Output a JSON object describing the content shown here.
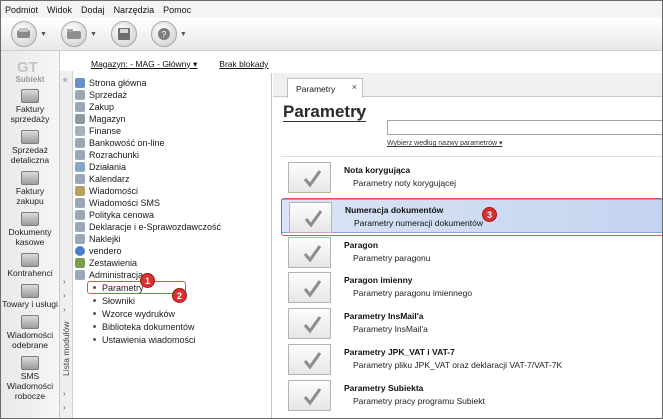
{
  "menu": [
    "Podmiot",
    "Widok",
    "Dodaj",
    "Narzędzia",
    "Pomoc"
  ],
  "logo": "Subiekt",
  "rail": [
    {
      "label": "Faktury sprzedaży"
    },
    {
      "label": "Sprzedaż detaliczna"
    },
    {
      "label": "Faktury zakupu"
    },
    {
      "label": "Dokumenty kasowe"
    },
    {
      "label": "Kontrahenci"
    },
    {
      "label": "Towary i usługi"
    },
    {
      "label": "Wiadomości odebrane"
    },
    {
      "label": "SMS Wiadomości robocze"
    }
  ],
  "side_strip": "Lista modułów",
  "storebar": {
    "warehouse": "Magazyn: - MAG - Główny ▾",
    "lock": "Brak blokady"
  },
  "nav": [
    {
      "label": "Strona główna",
      "color": "#6a8fc7"
    },
    {
      "label": "Sprzedaż",
      "color": "#9aa8b8"
    },
    {
      "label": "Zakup",
      "color": "#9aa8b8"
    },
    {
      "label": "Magazyn",
      "color": "#8c9aa8"
    },
    {
      "label": "Finanse",
      "color": "#a8b0ba"
    },
    {
      "label": "Bankowość on-line",
      "color": "#9aa8b8"
    },
    {
      "label": "Rozrachunki",
      "color": "#9aa8b8"
    },
    {
      "label": "Działania",
      "color": "#8aa6c7"
    },
    {
      "label": "Kalendarz",
      "color": "#9aa8b8"
    },
    {
      "label": "Wiadomości",
      "color": "#b8a060"
    },
    {
      "label": "Wiadomości SMS",
      "color": "#9aa8b8"
    },
    {
      "label": "Polityka cenowa",
      "color": "#9aa8b8"
    },
    {
      "label": "Deklaracje i e-Sprawozdawczość",
      "color": "#9aa8b8"
    },
    {
      "label": "Naklejki",
      "color": "#9aa8b8"
    },
    {
      "label": "vendero",
      "color": "#4a7fc7"
    },
    {
      "label": "Zestawienia",
      "color": "#78a050"
    },
    {
      "label": "Administracja",
      "color": "#9aa8b8"
    }
  ],
  "nav_sub": [
    "Parametry",
    "Słowniki",
    "Wzorce wydruków",
    "Biblioteka dokumentów",
    "Ustawienia wiadomości"
  ],
  "tab": {
    "label": "Parametry",
    "close": "×"
  },
  "page_title": "Parametry",
  "title_caret": "▾",
  "search_link": "Wybierz według nazwy parametrów ▾",
  "params": [
    {
      "name": "Nota korygująca",
      "desc": "Parametry noty korygującej",
      "selected": false
    },
    {
      "name": "Numeracja dokumentów",
      "desc": "Parametry numeracji dokumentów",
      "selected": true
    },
    {
      "name": "Paragon",
      "desc": "Parametry paragonu",
      "selected": false
    },
    {
      "name": "Paragon imienny",
      "desc": "Parametry paragonu imiennego",
      "selected": false
    },
    {
      "name": "Parametry InsMail'a",
      "desc": "Parametry InsMail'a",
      "selected": false
    },
    {
      "name": "Parametry JPK_VAT i VAT-7",
      "desc": "Parametry pliku JPK_VAT oraz deklaracji VAT-7/VAT-7K",
      "selected": false
    },
    {
      "name": "Parametry Subiekta",
      "desc": "Parametry pracy programu Subiekt",
      "selected": false
    }
  ],
  "markers": [
    "1",
    "2",
    "3"
  ]
}
